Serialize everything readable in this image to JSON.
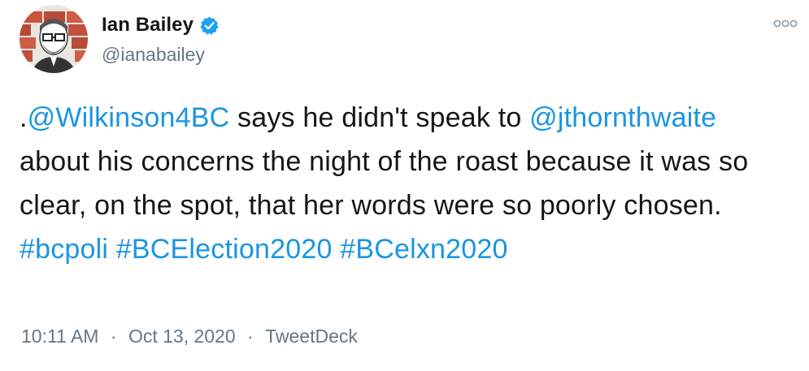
{
  "author": {
    "display_name": "Ian Bailey",
    "handle": "@ianabailey",
    "verified": true,
    "avatar_icon": "cartoon-avatar-with-glasses-brick-wall"
  },
  "more_icon": "more-options-icon",
  "tweet": {
    "segments": [
      {
        "text": ".",
        "type": "text"
      },
      {
        "text": "@Wilkinson4BC",
        "type": "mention"
      },
      {
        "text": " says he didn't speak to ",
        "type": "text"
      },
      {
        "text": "@jthornthwaite",
        "type": "mention"
      },
      {
        "text": " about his concerns the night of the roast  because it was so clear, on the spot, that her words were so poorly chosen. ",
        "type": "text"
      },
      {
        "text": "#bcpoli",
        "type": "hashtag"
      },
      {
        "text": " ",
        "type": "text"
      },
      {
        "text": "#BCElection2020",
        "type": "hashtag"
      },
      {
        "text": " ",
        "type": "text"
      },
      {
        "text": "#BCelxn2020",
        "type": "hashtag"
      }
    ]
  },
  "meta": {
    "time": "10:11 AM",
    "separator": "·",
    "date": "Oct 13, 2020",
    "source": "TweetDeck"
  },
  "colors": {
    "link": "#1b95e0",
    "secondary_text": "#657786",
    "primary_text": "#14171a",
    "verified_badge": "#1da1f2"
  }
}
